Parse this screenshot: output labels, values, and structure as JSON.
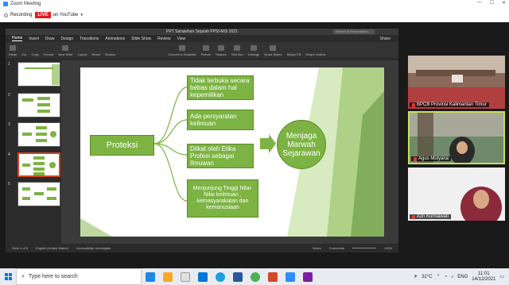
{
  "zoom": {
    "window_title": "Zoom Meeting",
    "recording_label": "Recording",
    "live_badge": "LIVE",
    "on_youtube": "on YouTube",
    "dropdown_icon": "chevron-down-icon"
  },
  "ppt": {
    "title": "PPT Sarasehan Sejarah PPSI-MSI 2021",
    "search_placeholder": "Search in Presentation",
    "share_label": "Share",
    "menu": [
      "Home",
      "Insert",
      "Draw",
      "Design",
      "Transitions",
      "Animations",
      "Slide Show",
      "Review",
      "View"
    ],
    "ribbon": [
      "Paste",
      "Cut",
      "Copy",
      "Format",
      "New Slide",
      "Layout",
      "Reset",
      "Section",
      "Convert to SmartArt",
      "Picture",
      "Shapes",
      "Text Box",
      "Arrange",
      "Quick Styles",
      "Shape Fill",
      "Shape Outline"
    ],
    "status_slide": "Slide 4 of 5",
    "status_lang": "English (United States)",
    "status_access": "Accessibility: Investigate",
    "status_notes": "Notes",
    "status_comments": "Comments",
    "zoom_level": "116%"
  },
  "thumbnails": [
    "1",
    "2",
    "3",
    "4",
    "5"
  ],
  "slide": {
    "center_label": "Proteksi",
    "items": [
      "Tidak terbuka secara bebas dalam hal kepemilikan",
      "Ada persyaratan keilmuan",
      "Diikat oleh Etika Profesi sebagai Ilmuwan",
      "Menjunjung Tinggi Nilai-Nilai keilmuan , kemasyarakatan dan kemanusiaan"
    ],
    "result_label": "Menjaga Marwah Sejarawan"
  },
  "participants": [
    {
      "name": "BPCB Provinsi Kalimantan Timur"
    },
    {
      "name": "Agus Mulyana"
    },
    {
      "name": "Azri Kurniawati"
    }
  ],
  "taskbar": {
    "search_placeholder": "Type here to search",
    "temperature": "32°C",
    "language": "ENG",
    "time": "11:01",
    "date": "14/12/2021"
  },
  "colors": {
    "accent_green": "#7cb342",
    "live_red": "#e21b1b",
    "active_speaker": "#c8e05a"
  }
}
